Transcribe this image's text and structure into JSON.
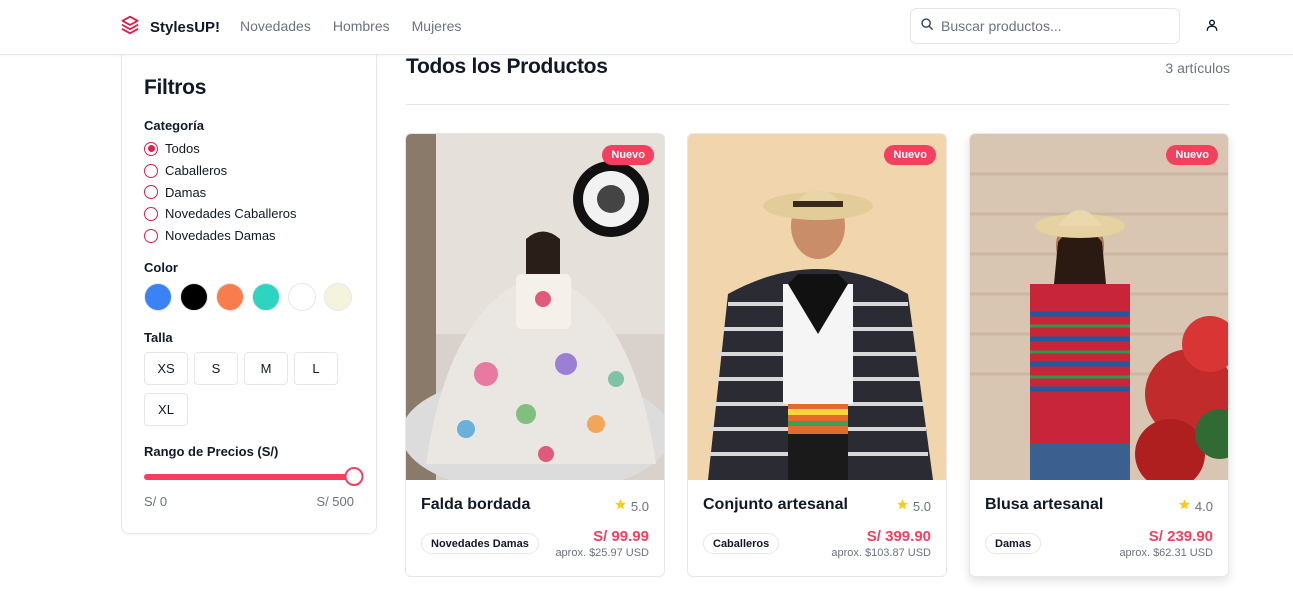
{
  "header": {
    "logo_text": "StylesUP!",
    "nav": [
      "Novedades",
      "Hombres",
      "Mujeres"
    ],
    "search_placeholder": "Buscar productos...",
    "icons": {
      "logo": "layers-icon",
      "search": "search-icon",
      "user": "user-icon"
    }
  },
  "sidebar": {
    "title": "Filtros",
    "category_label": "Categoría",
    "categories": [
      {
        "label": "Todos",
        "checked": true
      },
      {
        "label": "Caballeros",
        "checked": false
      },
      {
        "label": "Damas",
        "checked": false
      },
      {
        "label": "Novedades Caballeros",
        "checked": false
      },
      {
        "label": "Novedades Damas",
        "checked": false
      }
    ],
    "color_label": "Color",
    "colors": [
      "#3b82f6",
      "#000000",
      "#f97c4f",
      "#2dd4bf",
      "#ffffff",
      "#f4f4dc"
    ],
    "size_label": "Talla",
    "sizes": [
      "XS",
      "S",
      "M",
      "L",
      "XL"
    ],
    "price_label": "Rango de Precios (S/)",
    "price_min": "S/ 0",
    "price_max": "S/ 500",
    "slider_value_fraction": 1.0
  },
  "main": {
    "title": "Todos los Productos",
    "count": "3 artículos",
    "products": [
      {
        "badge": "Nuevo",
        "name": "Falda bordada",
        "rating": "5.0",
        "tag": "Novedades Damas",
        "price": "S/ 99.99",
        "approx": "aprox. $25.97 USD"
      },
      {
        "badge": "Nuevo",
        "name": "Conjunto artesanal",
        "rating": "5.0",
        "tag": "Caballeros",
        "price": "S/ 399.90",
        "approx": "aprox. $103.87 USD"
      },
      {
        "badge": "Nuevo",
        "name": "Blusa artesanal",
        "rating": "4.0",
        "tag": "Damas",
        "price": "S/ 239.90",
        "approx": "aprox. $62.31 USD"
      }
    ]
  },
  "colors": {
    "accent": "#f43f5e",
    "star": "#facc15",
    "muted": "#6b7280",
    "border": "#e5e7eb"
  }
}
